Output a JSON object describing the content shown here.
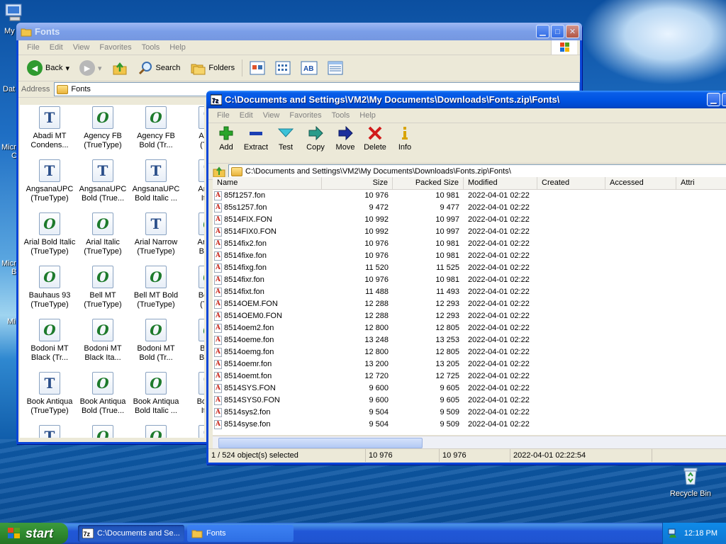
{
  "desktop": {
    "icons": [
      {
        "label": "My",
        "glyph": "my-computer-icon"
      },
      {
        "label": "Dat",
        "glyph": "shortcut-icon"
      },
      {
        "label": "Micro",
        "glyph": "shortcut-icon"
      },
      {
        "label": "C",
        "glyph": "shortcut-icon"
      },
      {
        "label": "Micro",
        "glyph": "shortcut-icon"
      },
      {
        "label": "B",
        "glyph": "shortcut-icon"
      },
      {
        "label": "Mi",
        "glyph": "shortcut-icon"
      },
      {
        "label": "Recycle Bin",
        "glyph": "recycle-bin-icon"
      }
    ]
  },
  "fonts_window": {
    "title": "Fonts",
    "menu": [
      "File",
      "Edit",
      "View",
      "Favorites",
      "Tools",
      "Help"
    ],
    "toolbar": {
      "back": "Back",
      "search": "Search",
      "folders": "Folders"
    },
    "address_label": "Address",
    "address_value": "Fonts",
    "items": [
      {
        "l1": "Abadi MT",
        "l2": "Condens...",
        "kind": "tt"
      },
      {
        "l1": "Agency FB",
        "l2": "(TrueType)",
        "kind": "ot"
      },
      {
        "l1": "Agency FB",
        "l2": "Bold (Tr...",
        "kind": "ot"
      },
      {
        "l1": "Aharo",
        "l2": "(True",
        "kind": "tt"
      },
      {
        "l1": "AngsanaUPC",
        "l2": "(TrueType)",
        "kind": "tt"
      },
      {
        "l1": "AngsanaUPC",
        "l2": "Bold (True...",
        "kind": "tt"
      },
      {
        "l1": "AngsanaUPC",
        "l2": "Bold Italic ...",
        "kind": "tt"
      },
      {
        "l1": "Angsa",
        "l2": "Italic",
        "kind": "tt"
      },
      {
        "l1": "Arial Bold Italic",
        "l2": "(TrueType)",
        "kind": "ot"
      },
      {
        "l1": "Arial Italic",
        "l2": "(TrueType)",
        "kind": "ot"
      },
      {
        "l1": "Arial Narrow",
        "l2": "(TrueType)",
        "kind": "tt"
      },
      {
        "l1": "Arial N",
        "l2": "Bold (",
        "kind": "ot"
      },
      {
        "l1": "Bauhaus 93",
        "l2": "(TrueType)",
        "kind": "ot"
      },
      {
        "l1": "Bell MT",
        "l2": "(TrueType)",
        "kind": "ot"
      },
      {
        "l1": "Bell MT Bold",
        "l2": "(TrueType)",
        "kind": "ot"
      },
      {
        "l1": "Bell M",
        "l2": "(True",
        "kind": "ot"
      },
      {
        "l1": "Bodoni MT",
        "l2": "Black (Tr...",
        "kind": "ot"
      },
      {
        "l1": "Bodoni MT",
        "l2": "Black Ita...",
        "kind": "ot"
      },
      {
        "l1": "Bodoni MT",
        "l2": "Bold (Tr...",
        "kind": "ot"
      },
      {
        "l1": "Bodo",
        "l2": "Bold I",
        "kind": "ot"
      },
      {
        "l1": "Book Antiqua",
        "l2": "(TrueType)",
        "kind": "tt"
      },
      {
        "l1": "Book Antiqua",
        "l2": "Bold (True...",
        "kind": "ot"
      },
      {
        "l1": "Book Antiqua",
        "l2": "Bold Italic ...",
        "kind": "ot"
      },
      {
        "l1": "Book A",
        "l2": "Italic",
        "kind": "tt"
      },
      {
        "l1": "",
        "l2": "",
        "kind": "tt"
      },
      {
        "l1": "",
        "l2": "",
        "kind": "ot"
      },
      {
        "l1": "",
        "l2": "",
        "kind": "ot"
      },
      {
        "l1": "",
        "l2": "",
        "kind": "tt"
      }
    ]
  },
  "zip_window": {
    "title": "C:\\Documents and Settings\\VM2\\My Documents\\Downloads\\Fonts.zip\\Fonts\\",
    "menu": [
      "File",
      "Edit",
      "View",
      "Favorites",
      "Tools",
      "Help"
    ],
    "tools": [
      {
        "label": "Add",
        "icon": "add-icon",
        "color": "#2aa52a"
      },
      {
        "label": "Extract",
        "icon": "extract-icon",
        "color": "#1a3fb3"
      },
      {
        "label": "Test",
        "icon": "test-icon",
        "color": "#27a9c9"
      },
      {
        "label": "Copy",
        "icon": "copy-icon",
        "color": "#1f8f8f"
      },
      {
        "label": "Move",
        "icon": "move-icon",
        "color": "#1c2f9c"
      },
      {
        "label": "Delete",
        "icon": "delete-icon",
        "color": "#d11a1a"
      },
      {
        "label": "Info",
        "icon": "info-icon",
        "color": "#d9a400"
      }
    ],
    "path": "C:\\Documents and Settings\\VM2\\My Documents\\Downloads\\Fonts.zip\\Fonts\\",
    "columns": [
      "Name",
      "Size",
      "Packed Size",
      "Modified",
      "Created",
      "Accessed",
      "Attri"
    ],
    "rows": [
      {
        "name": "85f1257.fon",
        "size": "10 976",
        "packed": "10 981",
        "modified": "2022-04-01 02:22"
      },
      {
        "name": "85s1257.fon",
        "size": "9 472",
        "packed": "9 477",
        "modified": "2022-04-01 02:22"
      },
      {
        "name": "8514FIX.FON",
        "size": "10 992",
        "packed": "10 997",
        "modified": "2022-04-01 02:22"
      },
      {
        "name": "8514FIX0.FON",
        "size": "10 992",
        "packed": "10 997",
        "modified": "2022-04-01 02:22"
      },
      {
        "name": "8514fix2.fon",
        "size": "10 976",
        "packed": "10 981",
        "modified": "2022-04-01 02:22"
      },
      {
        "name": "8514fixe.fon",
        "size": "10 976",
        "packed": "10 981",
        "modified": "2022-04-01 02:22"
      },
      {
        "name": "8514fixg.fon",
        "size": "11 520",
        "packed": "11 525",
        "modified": "2022-04-01 02:22"
      },
      {
        "name": "8514fixr.fon",
        "size": "10 976",
        "packed": "10 981",
        "modified": "2022-04-01 02:22"
      },
      {
        "name": "8514fixt.fon",
        "size": "11 488",
        "packed": "11 493",
        "modified": "2022-04-01 02:22"
      },
      {
        "name": "8514OEM.FON",
        "size": "12 288",
        "packed": "12 293",
        "modified": "2022-04-01 02:22"
      },
      {
        "name": "8514OEM0.FON",
        "size": "12 288",
        "packed": "12 293",
        "modified": "2022-04-01 02:22"
      },
      {
        "name": "8514oem2.fon",
        "size": "12 800",
        "packed": "12 805",
        "modified": "2022-04-01 02:22"
      },
      {
        "name": "8514oeme.fon",
        "size": "13 248",
        "packed": "13 253",
        "modified": "2022-04-01 02:22"
      },
      {
        "name": "8514oemg.fon",
        "size": "12 800",
        "packed": "12 805",
        "modified": "2022-04-01 02:22"
      },
      {
        "name": "8514oemr.fon",
        "size": "13 200",
        "packed": "13 205",
        "modified": "2022-04-01 02:22"
      },
      {
        "name": "8514oemt.fon",
        "size": "12 720",
        "packed": "12 725",
        "modified": "2022-04-01 02:22"
      },
      {
        "name": "8514SYS.FON",
        "size": "9 600",
        "packed": "9 605",
        "modified": "2022-04-01 02:22"
      },
      {
        "name": "8514SYS0.FON",
        "size": "9 600",
        "packed": "9 605",
        "modified": "2022-04-01 02:22"
      },
      {
        "name": "8514sys2.fon",
        "size": "9 504",
        "packed": "9 509",
        "modified": "2022-04-01 02:22"
      },
      {
        "name": "8514syse.fon",
        "size": "9 504",
        "packed": "9 509",
        "modified": "2022-04-01 02:22"
      }
    ],
    "status": {
      "selected": "1 / 524 object(s) selected",
      "size": "10 976",
      "packed": "10 976",
      "modified": "2022-04-01 02:22:54"
    }
  },
  "taskbar": {
    "start": "start",
    "tasks": [
      {
        "label": "C:\\Documents and Se...",
        "icon": "7zip-icon"
      },
      {
        "label": "Fonts",
        "icon": "folder-icon"
      }
    ],
    "clock": "12:18 PM"
  }
}
